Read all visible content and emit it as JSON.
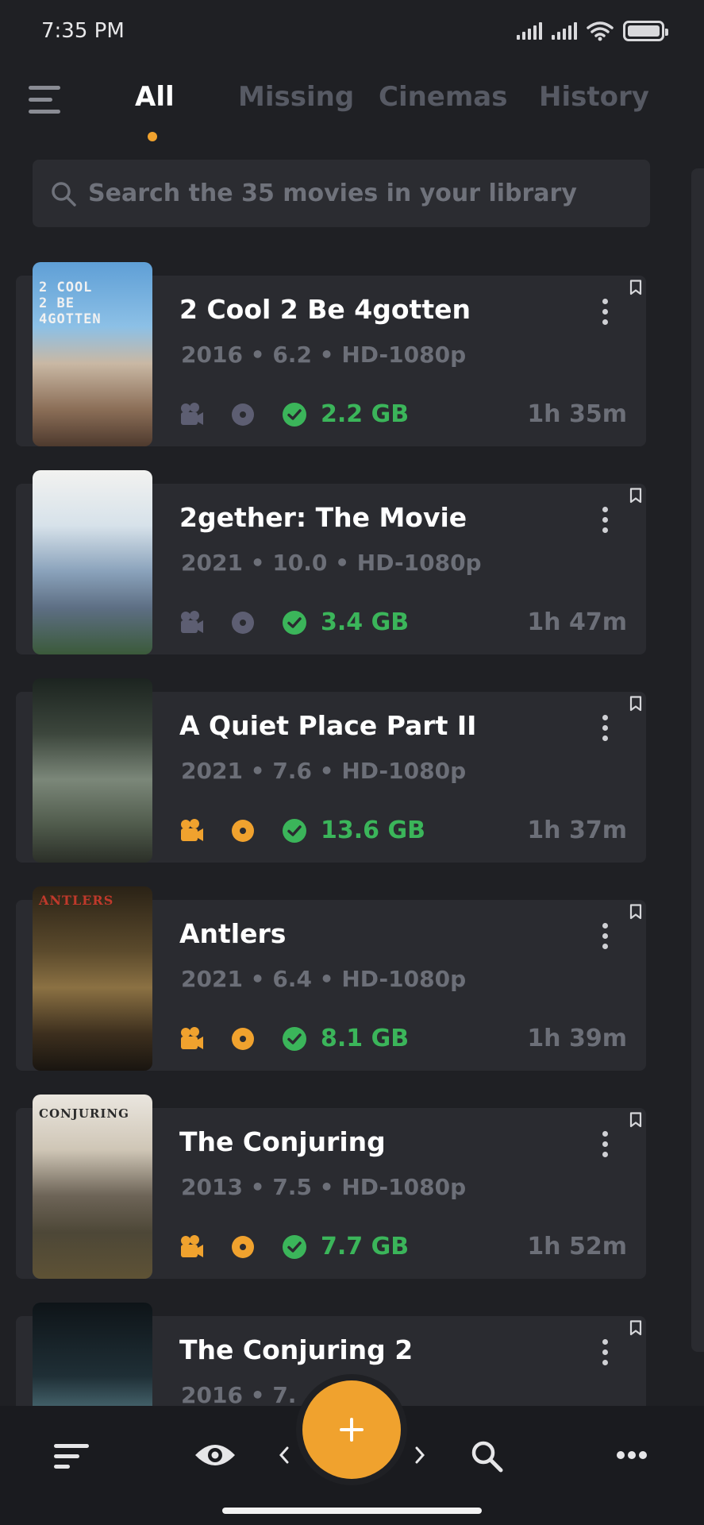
{
  "status": {
    "time": "7:35 PM"
  },
  "tabs": [
    {
      "label": "All",
      "active": true
    },
    {
      "label": "Missing",
      "active": false
    },
    {
      "label": "Cinemas",
      "active": false
    },
    {
      "label": "History",
      "active": false
    }
  ],
  "search": {
    "placeholder": "Search the 35 movies in your library"
  },
  "colors": {
    "accent": "#f0a22e",
    "ok": "#3bb55a",
    "muted": "#575a64",
    "background": "#1f2024",
    "card": "#2a2b30"
  },
  "movies": [
    {
      "title": "2 Cool 2 Be 4gotten",
      "meta": "2016  •  6.2  •  HD-1080p",
      "size": "2.2 GB",
      "duration": "1h 35m",
      "icons_active": false,
      "poster_text": "2 COOL\n2 BE\n4GOTTEN"
    },
    {
      "title": "2gether: The Movie",
      "meta": "2021  •  10.0  •  HD-1080p",
      "size": "3.4 GB",
      "duration": "1h 47m",
      "icons_active": false,
      "poster_text": ""
    },
    {
      "title": "A Quiet Place Part II",
      "meta": "2021  •  7.6  •  HD-1080p",
      "size": "13.6 GB",
      "duration": "1h 37m",
      "icons_active": true,
      "poster_text": ""
    },
    {
      "title": "Antlers",
      "meta": "2021  •  6.4  •  HD-1080p",
      "size": "8.1 GB",
      "duration": "1h 39m",
      "icons_active": true,
      "poster_text": "ANTLERS"
    },
    {
      "title": "The Conjuring",
      "meta": "2013  •  7.5  •  HD-1080p",
      "size": "7.7 GB",
      "duration": "1h 52m",
      "icons_active": true,
      "poster_text": "CONJURING"
    },
    {
      "title": "The Conjuring 2",
      "meta": "2016  •  7.",
      "size": "",
      "duration": "",
      "icons_active": true,
      "poster_text": ""
    }
  ],
  "bottom_nav": {
    "items": [
      "sort-icon",
      "eye-icon",
      "chevron-left-icon",
      "add-icon",
      "chevron-right-icon",
      "search-icon",
      "more-icon"
    ]
  }
}
